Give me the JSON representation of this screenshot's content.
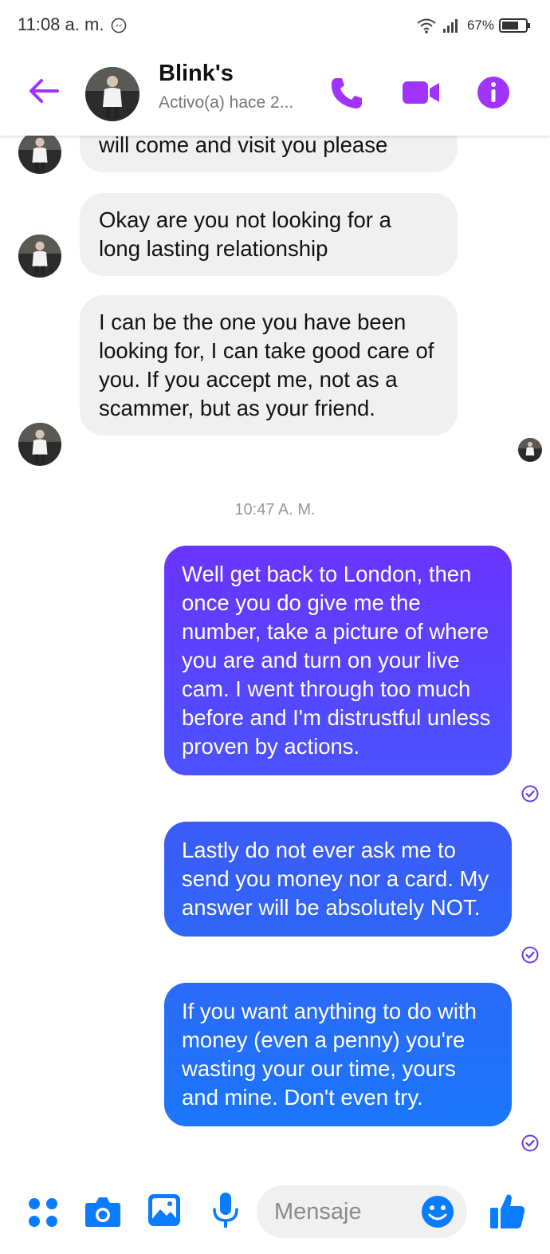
{
  "status_bar": {
    "time": "11:08 a. m.",
    "battery": "67%"
  },
  "header": {
    "contact_name": "Blink's",
    "active_status": "Activo(a) hace 2..."
  },
  "messages": {
    "incoming": [
      "will come and visit you please",
      "Okay are you not looking for a long lasting relationship",
      "I can be the one you have been looking for, I can take good care of you. If you accept me, not as a scammer, but as your friend."
    ],
    "timestamp": "10:47 A. M.",
    "outgoing": [
      "Well get back to London, then once you do give me the number, take a picture of where you are and turn on your live cam. I went through too much before and I'm distrustful unless proven by actions.",
      "Lastly do not ever ask me to send you money nor a card. My answer will be absolutely NOT.",
      "If you want anything to do with money (even a penny) you're wasting your our time, yours and mine. Don't even try."
    ]
  },
  "composer": {
    "placeholder": "Mensaje"
  },
  "icons": {
    "back": "arrow-left-icon",
    "call": "phone-icon",
    "video": "video-camera-icon",
    "info": "info-icon",
    "more": "four-dots-icon",
    "camera": "camera-icon",
    "gallery": "image-icon",
    "mic": "microphone-icon",
    "emoji": "smiley-icon",
    "like": "thumbs-up-icon",
    "seen": "check-circle-icon"
  },
  "colors": {
    "accent_purple": "#a033ff",
    "accent_blue": "#0a7cff",
    "bubble_gradient_top": "#6a34ff",
    "bubble_gradient_bottom": "#1b76fb",
    "incoming_bubble": "#f0f0f0"
  }
}
